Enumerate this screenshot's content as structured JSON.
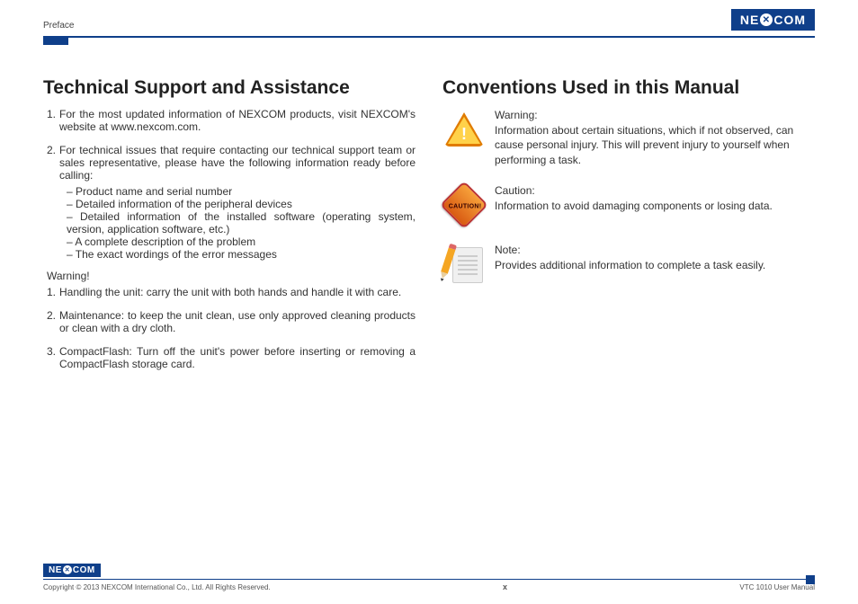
{
  "header": {
    "section": "Preface",
    "logo_text": "NEXCOM"
  },
  "left": {
    "heading": "Technical Support and Assistance",
    "items": [
      {
        "n": "1.",
        "t": "For the most updated information of NEXCOM products, visit NEXCOM's website at www.nexcom.com."
      },
      {
        "n": "2.",
        "t": "For technical issues that require contacting our technical support team or sales representative, please have the following information ready before calling:"
      }
    ],
    "subitems": [
      "Product name and serial number",
      "Detailed information of the peripheral devices",
      "Detailed information of the installed software (operating system, version, application software, etc.)",
      "A complete description of the problem",
      "The exact wordings of the error messages"
    ],
    "warning_label": "Warning!",
    "warnings": [
      {
        "n": "1.",
        "t": "Handling the unit: carry the unit with both hands and handle it with care."
      },
      {
        "n": "2.",
        "t": "Maintenance: to keep the unit clean, use only approved cleaning products or clean with a dry cloth."
      },
      {
        "n": "3.",
        "t": "CompactFlash: Turn off the unit's power before inserting or removing a CompactFlash storage card."
      }
    ]
  },
  "right": {
    "heading": "Conventions Used in this Manual",
    "items": [
      {
        "icon": "warning",
        "title": "Warning:",
        "body": "Information about certain situations, which if not observed, can cause personal injury. This will prevent injury to yourself when performing a task."
      },
      {
        "icon": "caution",
        "title": "Caution:",
        "body": "Information to avoid damaging components or losing data."
      },
      {
        "icon": "note",
        "title": "Note:",
        "body": "Provides additional information to complete a task easily."
      }
    ],
    "caution_word": "CAUTION!"
  },
  "footer": {
    "copyright": "Copyright © 2013 NEXCOM International Co., Ltd. All Rights Reserved.",
    "page": "x",
    "doc": "VTC 1010 User Manual"
  }
}
